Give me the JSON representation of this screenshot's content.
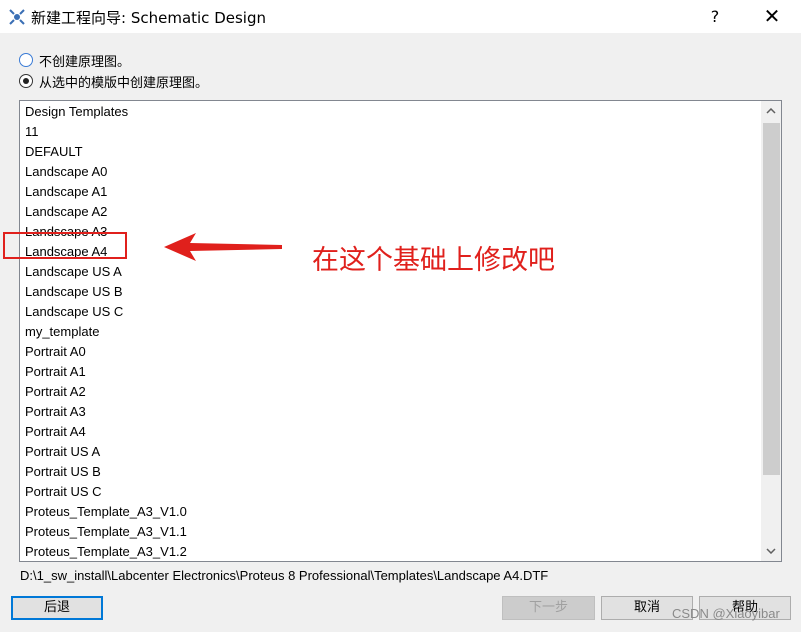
{
  "window": {
    "title": "新建工程向导: Schematic Design",
    "help_symbol": "?",
    "close_symbol": "✕",
    "app_icon": "proteus-app-icon"
  },
  "options": {
    "no_schematic": "不创建原理图。",
    "from_template": "从选中的模版中创建原理图。",
    "selected": "from_template"
  },
  "templates": {
    "items": [
      "Design Templates",
      "11",
      "DEFAULT",
      "Landscape A0",
      "Landscape A1",
      "Landscape A2",
      "Landscape A3",
      "Landscape A4",
      "Landscape US A",
      "Landscape US B",
      "Landscape US C",
      "my_template",
      "Portrait A0",
      "Portrait A1",
      "Portrait A2",
      "Portrait A3",
      "Portrait A4",
      "Portrait US A",
      "Portrait US B",
      "Portrait US C",
      "Proteus_Template_A3_V1.0",
      "Proteus_Template_A3_V1.1",
      "Proteus_Template_A3_V1.2"
    ],
    "highlighted": "Landscape A4"
  },
  "scroll": {
    "up_icon": "chevron-up-icon",
    "down_icon": "chevron-down-icon",
    "up_glyph": "⌃",
    "down_glyph": "⌄"
  },
  "path": "D:\\1_sw_install\\Labcenter Electronics\\Proteus 8 Professional\\Templates\\Landscape A4.DTF",
  "buttons": {
    "back": "后退",
    "next": "下一步",
    "cancel": "取消",
    "help": "帮助"
  },
  "annotation": {
    "text": "在这个基础上修改吧",
    "color": "#e0201c"
  },
  "watermark": "CSDN @Xiaoyibar"
}
